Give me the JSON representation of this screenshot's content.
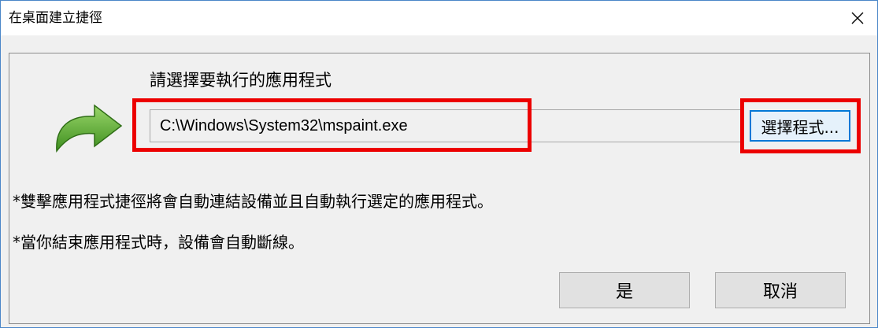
{
  "window": {
    "title": "在桌面建立捷徑",
    "close_icon": "close-icon"
  },
  "main": {
    "prompt": "請選擇要執行的應用程式",
    "path_value": "C:\\Windows\\System32\\mspaint.exe",
    "browse_label": "選擇程式...",
    "note1": "*雙擊應用程式捷徑將會自動連結設備並且自動執行選定的應用程式。",
    "note2": "*當你結束應用程式時，設備會自動斷線。"
  },
  "buttons": {
    "yes": "是",
    "cancel": "取消"
  },
  "colors": {
    "accent": "#0078d7",
    "highlight": "#ec0000",
    "arrow_green": "#5aa82e"
  }
}
